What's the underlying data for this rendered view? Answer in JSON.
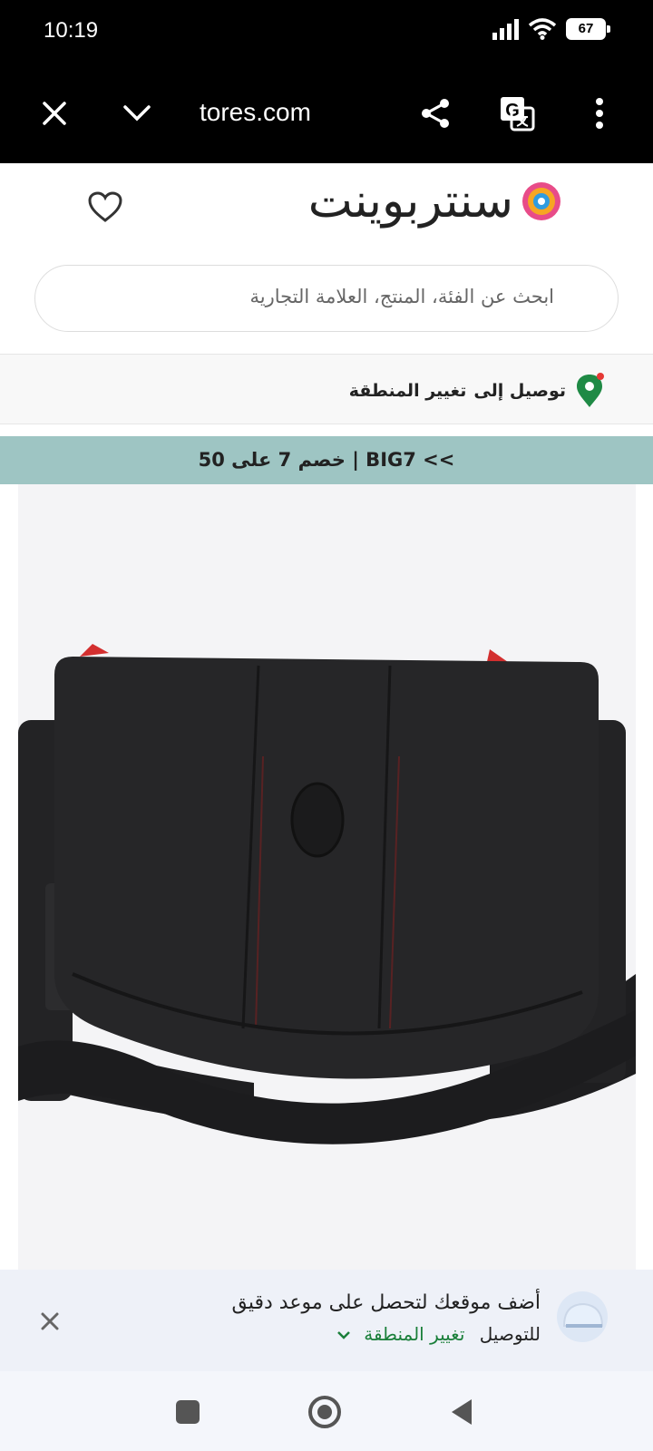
{
  "status_bar": {
    "time": "10:19",
    "battery": "67"
  },
  "browser": {
    "url": "tores.com"
  },
  "header": {
    "logo_text": "سنتربوينت",
    "search_placeholder": "ابحث عن الفئة، المنتج، العلامة التجارية"
  },
  "delivery": {
    "label": "توصيل إلى",
    "change": "تغيير المنطقة"
  },
  "promo": {
    "text": "خصم 7 على 50 | BIG7 <<"
  },
  "popup": {
    "line1": "أضف موقعك لتحصل على موعد دقيق",
    "delivery_word": "للتوصيل",
    "change": "تغيير المنطقة"
  },
  "colors": {
    "promo_bg": "#9ec5c3",
    "accent_green": "#1a7f3a"
  }
}
